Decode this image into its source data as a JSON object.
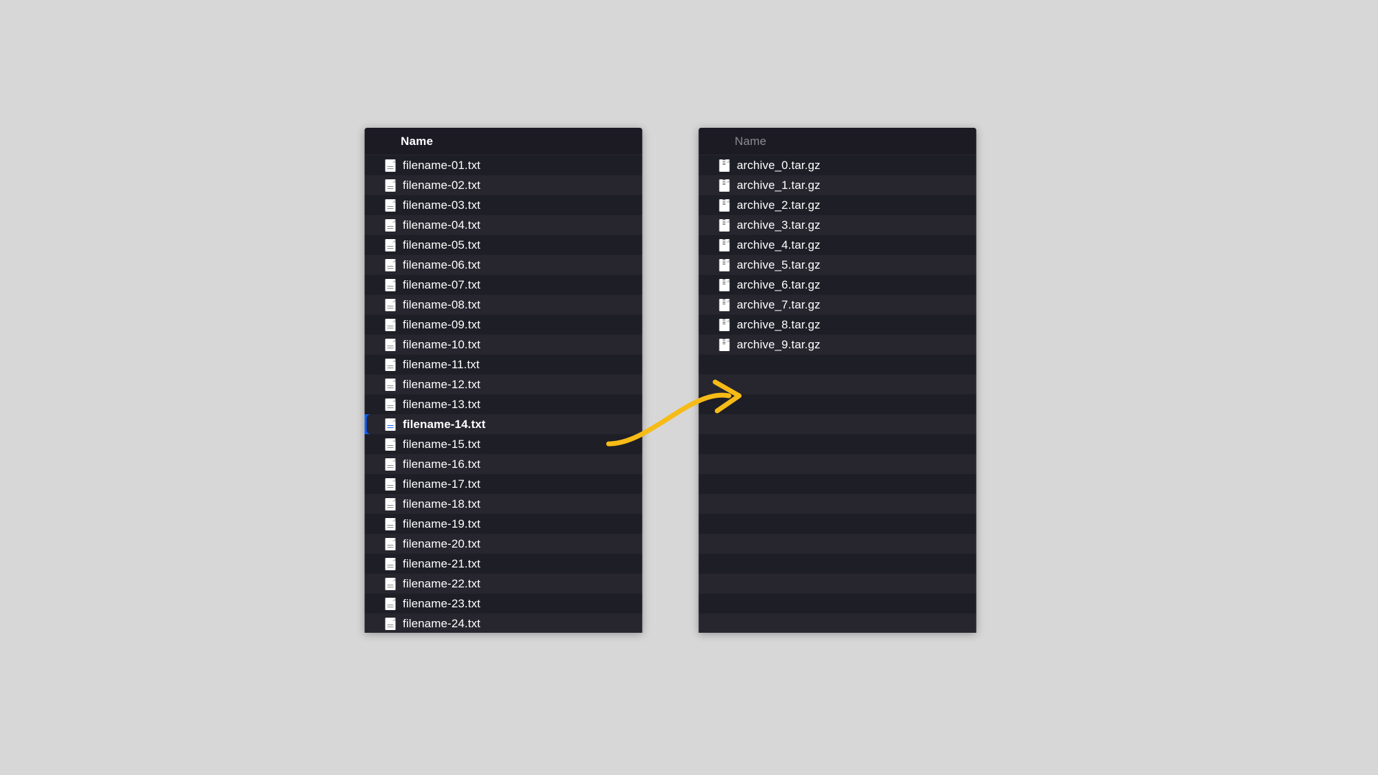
{
  "arrow_color": "#f6bb16",
  "selection_color": "#0a60ff",
  "left": {
    "header": "Name",
    "selected_index": 13,
    "files": [
      "filename-01.txt",
      "filename-02.txt",
      "filename-03.txt",
      "filename-04.txt",
      "filename-05.txt",
      "filename-06.txt",
      "filename-07.txt",
      "filename-08.txt",
      "filename-09.txt",
      "filename-10.txt",
      "filename-11.txt",
      "filename-12.txt",
      "filename-13.txt",
      "filename-14.txt",
      "filename-15.txt",
      "filename-16.txt",
      "filename-17.txt",
      "filename-18.txt",
      "filename-19.txt",
      "filename-20.txt",
      "filename-21.txt",
      "filename-22.txt",
      "filename-23.txt",
      "filename-24.txt"
    ]
  },
  "right": {
    "header": "Name",
    "total_rows": 24,
    "files": [
      "archive_0.tar.gz",
      "archive_1.tar.gz",
      "archive_2.tar.gz",
      "archive_3.tar.gz",
      "archive_4.tar.gz",
      "archive_5.tar.gz",
      "archive_6.tar.gz",
      "archive_7.tar.gz",
      "archive_8.tar.gz",
      "archive_9.tar.gz"
    ]
  }
}
